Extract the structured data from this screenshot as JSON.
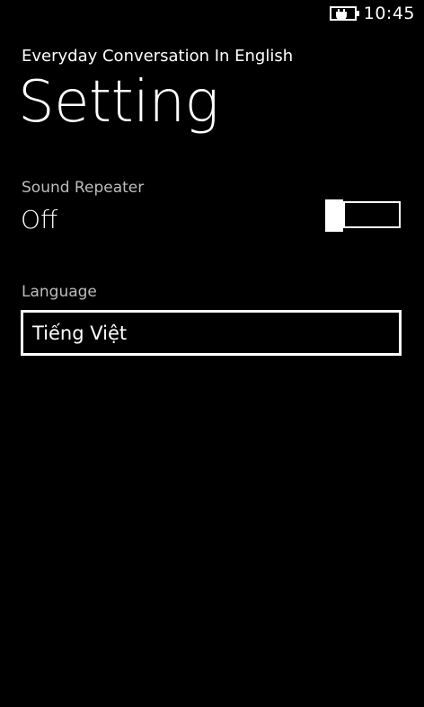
{
  "status_bar": {
    "battery_icon": "battery-charging-icon",
    "time": "10:45"
  },
  "header": {
    "app_title": "Everyday Conversation In English",
    "page_title": "Setting"
  },
  "settings": {
    "sound_repeater": {
      "label": "Sound Repeater",
      "state_text": "Off",
      "is_on": false
    },
    "language": {
      "label": "Language",
      "selected": "Tiếng Việt"
    }
  },
  "colors": {
    "background": "#000000",
    "foreground": "#ffffff",
    "label": "#bdbdbd"
  }
}
